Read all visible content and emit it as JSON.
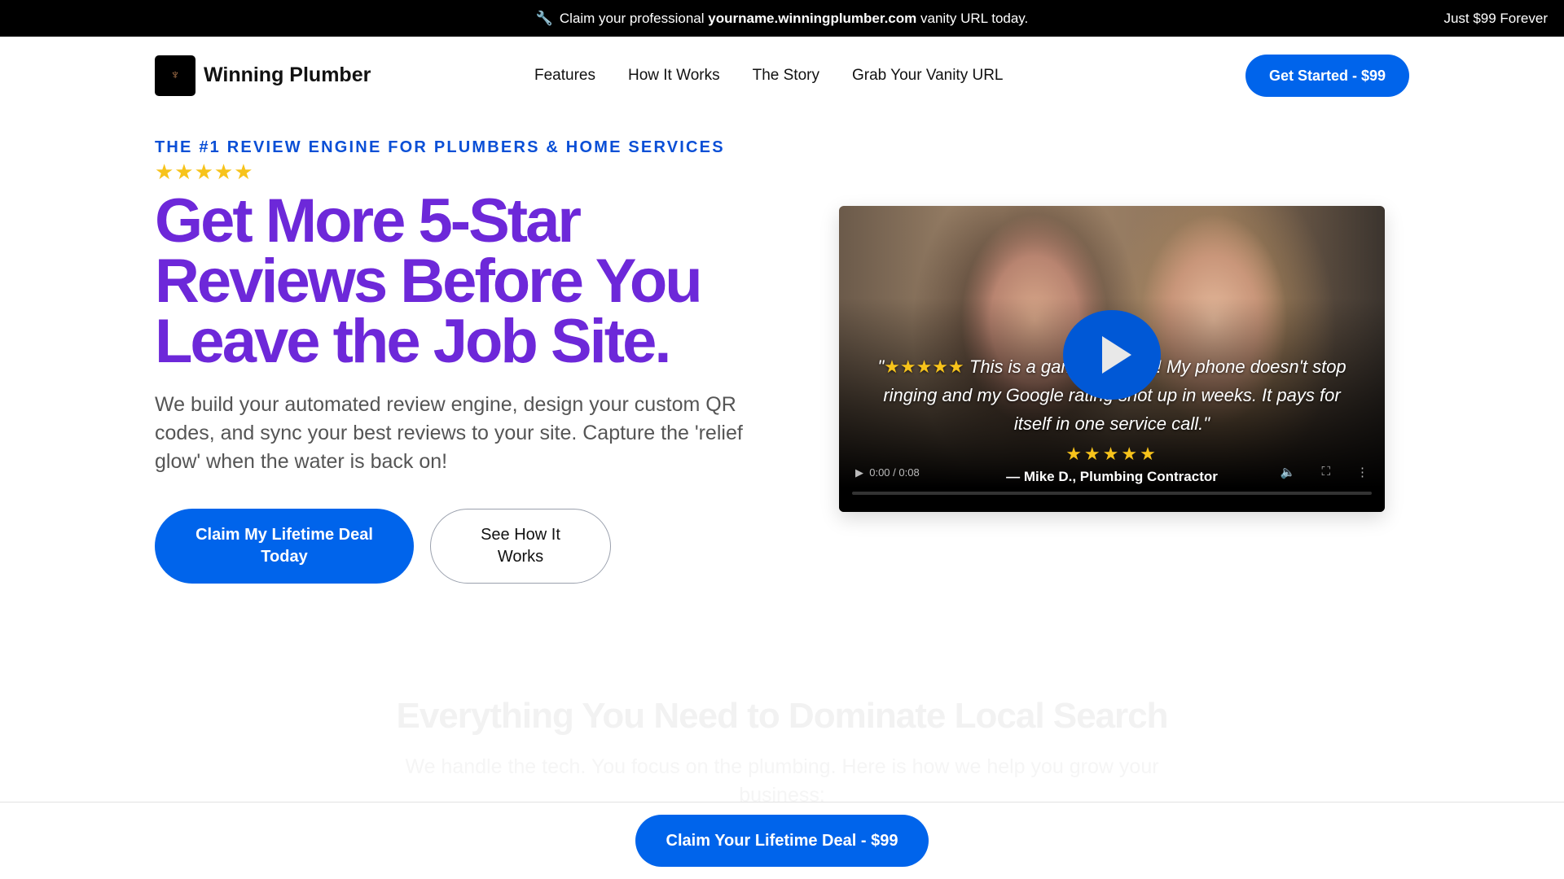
{
  "topbar": {
    "prefix": "Claim your professional",
    "domain": "yourname.winningplumber.com",
    "suffix": "vanity URL today.",
    "right": "Just $99 Forever"
  },
  "nav": {
    "brand": "Winning Plumber",
    "links": [
      "Features",
      "How It Works",
      "The Story",
      "Grab Your Vanity URL"
    ],
    "cta": "Get Started - $99"
  },
  "hero": {
    "eyebrow": "THE #1 REVIEW ENGINE FOR PLUMBERS & HOME SERVICES",
    "stars": "★★★★★",
    "rating": 5,
    "title": "Get More 5-Star Reviews Before You Leave the Job Site.",
    "lead": "We build your automated review engine, design your custom QR codes, and sync your best reviews to your site. Capture the 'relief glow' when the water is back on!",
    "primary": "Claim My Lifetime Deal Today",
    "secondary": "See How It Works"
  },
  "video": {
    "quote_open": "\"",
    "quote_stars": "★★★★★",
    "quote": " This is a game-changer! My phone doesn't stop ringing and my Google rating shot up in weeks. It pays for itself in one service call.\"",
    "stars": "★★★★★",
    "author": "— Mike D., Plumbing Contractor",
    "time": "0:00 / 0:08",
    "progress": 0
  },
  "section": {
    "title": "Everything You Need to Dominate Local Search",
    "subtitle": "We handle the tech. You focus on the plumbing. Here is how we help you grow your business:"
  },
  "sticky": {
    "cta": "Claim Your Lifetime Deal - $99"
  },
  "colors": {
    "brand": "#0064eb",
    "headline": "#6d28d9",
    "eyebrow": "#0a4fd6",
    "star": "#f7c31b"
  }
}
